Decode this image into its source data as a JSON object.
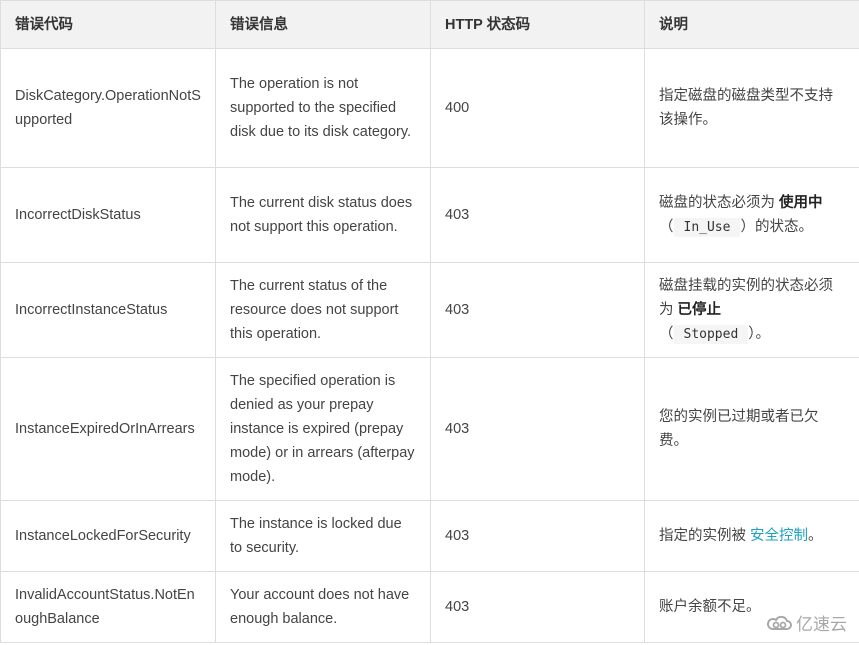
{
  "table": {
    "headers": [
      "错误代码",
      "错误信息",
      "HTTP 状态码",
      "说明"
    ],
    "rows": [
      {
        "code": "DiskCategory.OperationNotSupported",
        "message": "The operation is not supported to the specified disk due to its disk category.",
        "status": "400",
        "desc": {
          "text": "指定磁盘的磁盘类型不支持该操作。"
        }
      },
      {
        "code": "IncorrectDiskStatus",
        "message": "The current disk status does not support this operation.",
        "status": "403",
        "desc": {
          "pre": "磁盘的状态必须为 ",
          "bold": "使用中",
          "open": "（",
          "code": "In_Use",
          "close": "）的状态。"
        }
      },
      {
        "code": "IncorrectInstanceStatus",
        "message": "The current status of the resource does not support this operation.",
        "status": "403",
        "desc": {
          "pre": "磁盘挂载的实例的状态必须为 ",
          "bold": "已停止",
          "open": "（",
          "code": "Stopped",
          "close": "）。"
        }
      },
      {
        "code": "InstanceExpiredOrInArrears",
        "message": "The specified operation is denied as your prepay instance is expired (prepay mode) or in arrears (afterpay mode).",
        "status": "403",
        "desc": {
          "text": "您的实例已过期或者已欠费。"
        }
      },
      {
        "code": "InstanceLockedForSecurity",
        "message": "The instance is locked due to security.",
        "status": "403",
        "desc": {
          "pre": "指定的实例被 ",
          "link": "安全控制",
          "post": "。"
        }
      },
      {
        "code": "InvalidAccountStatus.NotEnoughBalance",
        "message": "Your account does not have enough balance.",
        "status": "403",
        "desc": {
          "text": "账户余额不足。"
        }
      }
    ]
  },
  "colors": {
    "link": "#1ea1c1",
    "header_bg": "#f2f2f2",
    "border": "#dddddd"
  },
  "watermark": {
    "icon": "cloud-logo-icon",
    "text": "亿速云"
  }
}
